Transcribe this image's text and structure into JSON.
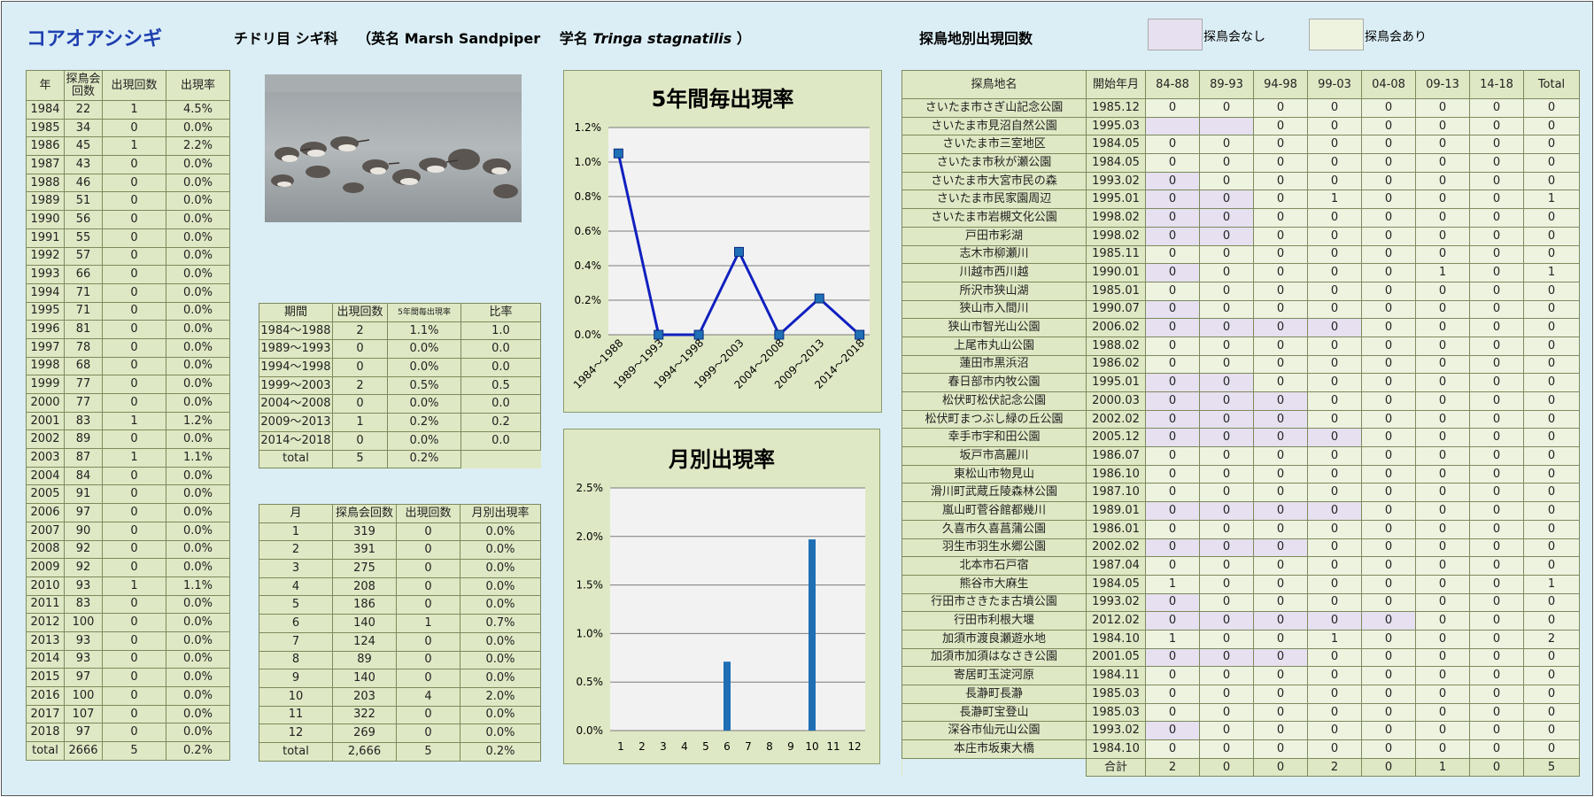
{
  "header": {
    "species": "コアオアシシギ",
    "order_family": "チドリ目 シギ科",
    "english_label": "（英名 Marsh Sandpiper",
    "scientific_label": "学名",
    "scientific_name": "Tringa stagnatilis",
    "closing": "）",
    "location_title": "探鳥地別出現回数",
    "legend_none": "探鳥会なし",
    "legend_yes": "探鳥会あり"
  },
  "colors": {
    "no_event": "#e6e0f0",
    "event": "#eef3e0",
    "table_bg": "#dfe8c4",
    "line": "#1020c0",
    "bar": "#1f6fb5"
  },
  "yearly": {
    "headers": [
      "年",
      "探鳥会回数",
      "出現回数",
      "出現率"
    ],
    "rows": [
      [
        "1984",
        "22",
        "1",
        "4.5%"
      ],
      [
        "1985",
        "34",
        "0",
        "0.0%"
      ],
      [
        "1986",
        "45",
        "1",
        "2.2%"
      ],
      [
        "1987",
        "43",
        "0",
        "0.0%"
      ],
      [
        "1988",
        "46",
        "0",
        "0.0%"
      ],
      [
        "1989",
        "51",
        "0",
        "0.0%"
      ],
      [
        "1990",
        "56",
        "0",
        "0.0%"
      ],
      [
        "1991",
        "55",
        "0",
        "0.0%"
      ],
      [
        "1992",
        "57",
        "0",
        "0.0%"
      ],
      [
        "1993",
        "66",
        "0",
        "0.0%"
      ],
      [
        "1994",
        "71",
        "0",
        "0.0%"
      ],
      [
        "1995",
        "71",
        "0",
        "0.0%"
      ],
      [
        "1996",
        "81",
        "0",
        "0.0%"
      ],
      [
        "1997",
        "78",
        "0",
        "0.0%"
      ],
      [
        "1998",
        "68",
        "0",
        "0.0%"
      ],
      [
        "1999",
        "77",
        "0",
        "0.0%"
      ],
      [
        "2000",
        "77",
        "0",
        "0.0%"
      ],
      [
        "2001",
        "83",
        "1",
        "1.2%"
      ],
      [
        "2002",
        "89",
        "0",
        "0.0%"
      ],
      [
        "2003",
        "87",
        "1",
        "1.1%"
      ],
      [
        "2004",
        "84",
        "0",
        "0.0%"
      ],
      [
        "2005",
        "91",
        "0",
        "0.0%"
      ],
      [
        "2006",
        "97",
        "0",
        "0.0%"
      ],
      [
        "2007",
        "90",
        "0",
        "0.0%"
      ],
      [
        "2008",
        "92",
        "0",
        "0.0%"
      ],
      [
        "2009",
        "92",
        "0",
        "0.0%"
      ],
      [
        "2010",
        "93",
        "1",
        "1.1%"
      ],
      [
        "2011",
        "83",
        "0",
        "0.0%"
      ],
      [
        "2012",
        "100",
        "0",
        "0.0%"
      ],
      [
        "2013",
        "93",
        "0",
        "0.0%"
      ],
      [
        "2014",
        "93",
        "0",
        "0.0%"
      ],
      [
        "2015",
        "97",
        "0",
        "0.0%"
      ],
      [
        "2016",
        "100",
        "0",
        "0.0%"
      ],
      [
        "2017",
        "107",
        "0",
        "0.0%"
      ],
      [
        "2018",
        "97",
        "0",
        "0.0%"
      ],
      [
        "total",
        "2666",
        "5",
        "0.2%"
      ]
    ]
  },
  "period": {
    "headers": [
      "期間",
      "出現回数",
      "5年間毎出現率",
      "比率"
    ],
    "rows": [
      [
        "1984～1988",
        "2",
        "1.1%",
        "1.0"
      ],
      [
        "1989～1993",
        "0",
        "0.0%",
        "0.0"
      ],
      [
        "1994～1998",
        "0",
        "0.0%",
        "0.0"
      ],
      [
        "1999～2003",
        "2",
        "0.5%",
        "0.5"
      ],
      [
        "2004～2008",
        "0",
        "0.0%",
        "0.0"
      ],
      [
        "2009～2013",
        "1",
        "0.2%",
        "0.2"
      ],
      [
        "2014～2018",
        "0",
        "0.0%",
        "0.0"
      ]
    ],
    "total": [
      "total",
      "5",
      "0.2%"
    ]
  },
  "monthly": {
    "headers": [
      "月",
      "探鳥会回数",
      "出現回数",
      "月別出現率"
    ],
    "rows": [
      [
        "1",
        "319",
        "0",
        "0.0%"
      ],
      [
        "2",
        "391",
        "0",
        "0.0%"
      ],
      [
        "3",
        "275",
        "0",
        "0.0%"
      ],
      [
        "4",
        "208",
        "0",
        "0.0%"
      ],
      [
        "5",
        "186",
        "0",
        "0.0%"
      ],
      [
        "6",
        "140",
        "1",
        "0.7%"
      ],
      [
        "7",
        "124",
        "0",
        "0.0%"
      ],
      [
        "8",
        "89",
        "0",
        "0.0%"
      ],
      [
        "9",
        "140",
        "0",
        "0.0%"
      ],
      [
        "10",
        "203",
        "4",
        "2.0%"
      ],
      [
        "11",
        "322",
        "0",
        "0.0%"
      ],
      [
        "12",
        "269",
        "0",
        "0.0%"
      ],
      [
        "total",
        "2,666",
        "5",
        "0.2%"
      ]
    ]
  },
  "location": {
    "headers": [
      "探鳥地名",
      "開始年月",
      "84-88",
      "89-93",
      "94-98",
      "99-03",
      "04-08",
      "09-13",
      "14-18",
      "Total"
    ],
    "rows": [
      [
        "さいたま市さぎ山記念公園",
        "1985.12",
        "0",
        "0",
        "0",
        "0",
        "0",
        "0",
        "0",
        "0"
      ],
      [
        "さいたま市見沼自然公園",
        "1995.03",
        "",
        "",
        "0",
        "0",
        "0",
        "0",
        "0",
        "0"
      ],
      [
        "さいたま市三室地区",
        "1984.05",
        "0",
        "0",
        "0",
        "0",
        "0",
        "0",
        "0",
        "0"
      ],
      [
        "さいたま市秋が瀬公園",
        "1984.05",
        "0",
        "0",
        "0",
        "0",
        "0",
        "0",
        "0",
        "0"
      ],
      [
        "さいたま市大宮市民の森",
        "1993.02",
        "0",
        "0",
        "0",
        "0",
        "0",
        "0",
        "0",
        "0"
      ],
      [
        "さいたま市民家園周辺",
        "1995.01",
        "0",
        "0",
        "0",
        "1",
        "0",
        "0",
        "0",
        "1"
      ],
      [
        "さいたま市岩槻文化公園",
        "1998.02",
        "0",
        "0",
        "0",
        "0",
        "0",
        "0",
        "0",
        "0"
      ],
      [
        "戸田市彩湖",
        "1998.02",
        "0",
        "0",
        "0",
        "0",
        "0",
        "0",
        "0",
        "0"
      ],
      [
        "志木市柳瀬川",
        "1985.11",
        "0",
        "0",
        "0",
        "0",
        "0",
        "0",
        "0",
        "0"
      ],
      [
        "川越市西川越",
        "1990.01",
        "0",
        "0",
        "0",
        "0",
        "0",
        "1",
        "0",
        "1"
      ],
      [
        "所沢市狭山湖",
        "1985.01",
        "0",
        "0",
        "0",
        "0",
        "0",
        "0",
        "0",
        "0"
      ],
      [
        "狭山市入間川",
        "1990.07",
        "0",
        "0",
        "0",
        "0",
        "0",
        "0",
        "0",
        "0"
      ],
      [
        "狭山市智光山公園",
        "2006.02",
        "0",
        "0",
        "0",
        "0",
        "0",
        "0",
        "0",
        "0"
      ],
      [
        "上尾市丸山公園",
        "1988.02",
        "0",
        "0",
        "0",
        "0",
        "0",
        "0",
        "0",
        "0"
      ],
      [
        "蓮田市黒浜沼",
        "1986.02",
        "0",
        "0",
        "0",
        "0",
        "0",
        "0",
        "0",
        "0"
      ],
      [
        "春日部市内牧公園",
        "1995.01",
        "0",
        "0",
        "0",
        "0",
        "0",
        "0",
        "0",
        "0"
      ],
      [
        "松伏町松伏記念公園",
        "2000.03",
        "0",
        "0",
        "0",
        "0",
        "0",
        "0",
        "0",
        "0"
      ],
      [
        "松伏町まつぶし緑の丘公園",
        "2002.02",
        "0",
        "0",
        "0",
        "0",
        "0",
        "0",
        "0",
        "0"
      ],
      [
        "幸手市宇和田公園",
        "2005.12",
        "0",
        "0",
        "0",
        "0",
        "0",
        "0",
        "0",
        "0"
      ],
      [
        "坂戸市高麗川",
        "1986.07",
        "0",
        "0",
        "0",
        "0",
        "0",
        "0",
        "0",
        "0"
      ],
      [
        "東松山市物見山",
        "1986.10",
        "0",
        "0",
        "0",
        "0",
        "0",
        "0",
        "0",
        "0"
      ],
      [
        "滑川町武蔵丘陵森林公園",
        "1987.10",
        "0",
        "0",
        "0",
        "0",
        "0",
        "0",
        "0",
        "0"
      ],
      [
        "嵐山町菅谷館都幾川",
        "1989.01",
        "0",
        "0",
        "0",
        "0",
        "0",
        "0",
        "0",
        "0"
      ],
      [
        "久喜市久喜菖蒲公園",
        "1986.01",
        "0",
        "0",
        "0",
        "0",
        "0",
        "0",
        "0",
        "0"
      ],
      [
        "羽生市羽生水郷公園",
        "2002.02",
        "0",
        "0",
        "0",
        "0",
        "0",
        "0",
        "0",
        "0"
      ],
      [
        "北本市石戸宿",
        "1987.04",
        "0",
        "0",
        "0",
        "0",
        "0",
        "0",
        "0",
        "0"
      ],
      [
        "熊谷市大麻生",
        "1984.05",
        "1",
        "0",
        "0",
        "0",
        "0",
        "0",
        "0",
        "1"
      ],
      [
        "行田市さきたま古墳公園",
        "1993.02",
        "0",
        "0",
        "0",
        "0",
        "0",
        "0",
        "0",
        "0"
      ],
      [
        "行田市利根大堰",
        "2012.02",
        "0",
        "0",
        "0",
        "0",
        "0",
        "0",
        "0",
        "0"
      ],
      [
        "加須市渡良瀬遊水地",
        "1984.10",
        "1",
        "0",
        "0",
        "1",
        "0",
        "0",
        "0",
        "2"
      ],
      [
        "加須市加須はなさき公園",
        "2001.05",
        "0",
        "0",
        "0",
        "0",
        "0",
        "0",
        "0",
        "0"
      ],
      [
        "寄居町玉淀河原",
        "1984.11",
        "0",
        "0",
        "0",
        "0",
        "0",
        "0",
        "0",
        "0"
      ],
      [
        "長瀞町長瀞",
        "1985.03",
        "0",
        "0",
        "0",
        "0",
        "0",
        "0",
        "0",
        "0"
      ],
      [
        "長瀞町宝登山",
        "1985.03",
        "0",
        "0",
        "0",
        "0",
        "0",
        "0",
        "0",
        "0"
      ],
      [
        "深谷市仙元山公園",
        "1993.02",
        "0",
        "0",
        "0",
        "0",
        "0",
        "0",
        "0",
        "0"
      ],
      [
        "本庄市坂東大橋",
        "1984.10",
        "0",
        "0",
        "0",
        "0",
        "0",
        "0",
        "0",
        "0"
      ]
    ],
    "shaded": [
      [],
      [
        2,
        3
      ],
      [],
      [],
      [
        2
      ],
      [
        2,
        3
      ],
      [
        2,
        3
      ],
      [
        2,
        3
      ],
      [],
      [
        2
      ],
      [],
      [
        2
      ],
      [
        2,
        3,
        4,
        5
      ],
      [],
      [],
      [
        2,
        3
      ],
      [
        2,
        3,
        4
      ],
      [
        2,
        3,
        4
      ],
      [
        2,
        3,
        4,
        5
      ],
      [],
      [],
      [],
      [
        2,
        3,
        4,
        5
      ],
      [],
      [
        2,
        3,
        4
      ],
      [],
      [],
      [
        2
      ],
      [
        2,
        3,
        4,
        5,
        6
      ],
      [],
      [
        2,
        3,
        4
      ],
      [],
      [],
      [],
      [
        2
      ],
      []
    ],
    "total": [
      "合計",
      "2",
      "0",
      "0",
      "2",
      "0",
      "1",
      "0",
      "5"
    ]
  },
  "chart_data": [
    {
      "type": "line",
      "title": "5年間毎出現率",
      "categories": [
        "1984～1988",
        "1989～1993",
        "1994～1998",
        "1999～2003",
        "2004～2008",
        "2009～2013",
        "2014～2018"
      ],
      "values": [
        1.05,
        0.0,
        0.0,
        0.48,
        0.0,
        0.21,
        0.0
      ],
      "unit": "%",
      "ylim": [
        0,
        1.2
      ],
      "yticks": [
        "0.0%",
        "0.2%",
        "0.4%",
        "0.6%",
        "0.8%",
        "1.0%",
        "1.2%"
      ],
      "grid": true
    },
    {
      "type": "bar",
      "title": "月別出現率",
      "categories": [
        "1",
        "2",
        "3",
        "4",
        "5",
        "6",
        "7",
        "8",
        "9",
        "10",
        "11",
        "12"
      ],
      "values": [
        0,
        0,
        0,
        0,
        0,
        0.71,
        0,
        0,
        0,
        1.97,
        0,
        0
      ],
      "unit": "%",
      "ylim": [
        0,
        2.5
      ],
      "yticks": [
        "0.0%",
        "0.5%",
        "1.0%",
        "1.5%",
        "2.0%",
        "2.5%"
      ],
      "grid": true
    }
  ]
}
